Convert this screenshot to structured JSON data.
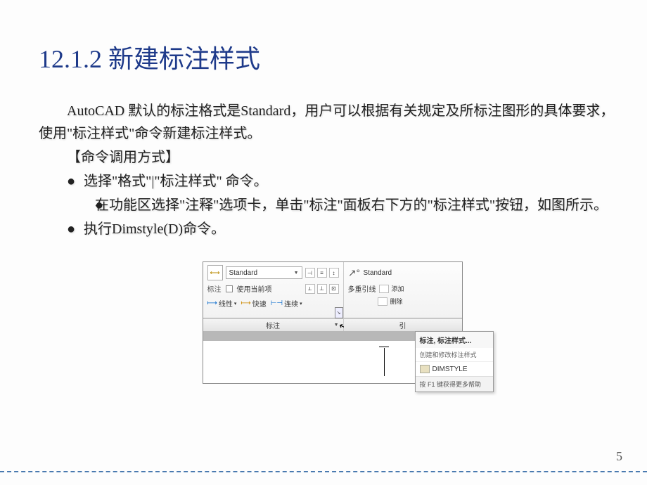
{
  "title": "12.1.2 新建标注样式",
  "para1": "AutoCAD 默认的标注格式是Standard，用户可以根据有关规定及所标注图形的具体要求，使用\"标注样式\"命令新建标注样式。",
  "sub_heading": "【命令调用方式】",
  "bullets": {
    "b1": "选择\"格式\"|\"标注样式\" 命令。",
    "b2": "在功能区选择\"注释\"选项卡，单击\"标注\"面板右下方的\"标注样式\"按钮，如图所示。",
    "b3": "执行Dimstyle(D)命令。"
  },
  "bullet_symbol": "●",
  "page_number": "5",
  "screenshot": {
    "panel_left": {
      "combo_value": "Standard",
      "label_biaozhu": "标注",
      "use_current": "使用当前项",
      "linear": "线性",
      "quick": "快速",
      "continuous": "连续",
      "footer": "标注"
    },
    "panel_right": {
      "standard": "Standard",
      "multileader_label": "多重引线",
      "add": "添加",
      "del": "删除",
      "footer": "引"
    },
    "tooltip": {
      "title": "标注, 标注样式...",
      "subtitle": "创建和修改标注样式",
      "cmd": "DIMSTYLE",
      "help": "按 F1 键获得更多帮助"
    }
  }
}
